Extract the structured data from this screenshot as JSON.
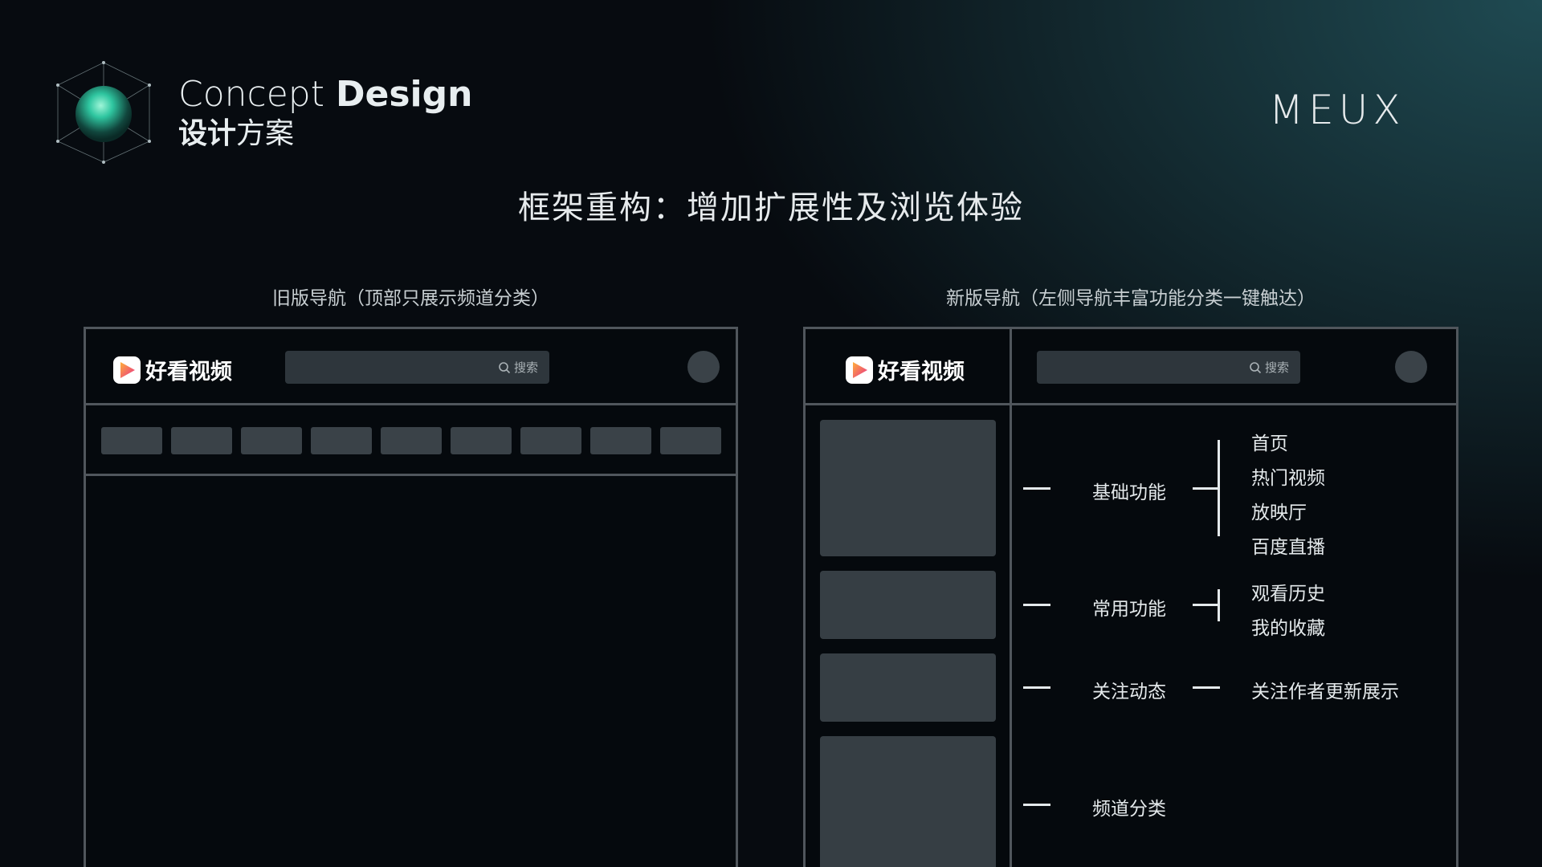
{
  "header": {
    "concept_light": "Concept",
    "concept_bold": "Design",
    "sub_bold": "设计",
    "sub_light": "方案",
    "brand": "MEUX"
  },
  "title": "框架重构：增加扩展性及浏览体验",
  "old_panel": {
    "caption": "旧版导航（顶部只展示频道分类）",
    "app_name": "好看视频",
    "search_label": "搜索",
    "tab_count": 9
  },
  "new_panel": {
    "caption": "新版导航（左侧导航丰富功能分类一键触达）",
    "app_name": "好看视频",
    "search_label": "搜索",
    "groups": [
      {
        "label": "基础功能",
        "items": [
          "首页",
          "热门视频",
          "放映厅",
          "百度直播"
        ]
      },
      {
        "label": "常用功能",
        "items": [
          "观看历史",
          "我的收藏"
        ]
      },
      {
        "label": "关注动态",
        "items": [
          "关注作者更新展示"
        ]
      },
      {
        "label": "频道分类",
        "items": []
      }
    ]
  },
  "colors": {
    "accent_play_start": "#ffb03a",
    "accent_play_end": "#e8308a",
    "sphere": "#2fc6a0"
  },
  "icons": [
    "sphere-logo-icon",
    "play-logo-icon",
    "search-icon"
  ]
}
